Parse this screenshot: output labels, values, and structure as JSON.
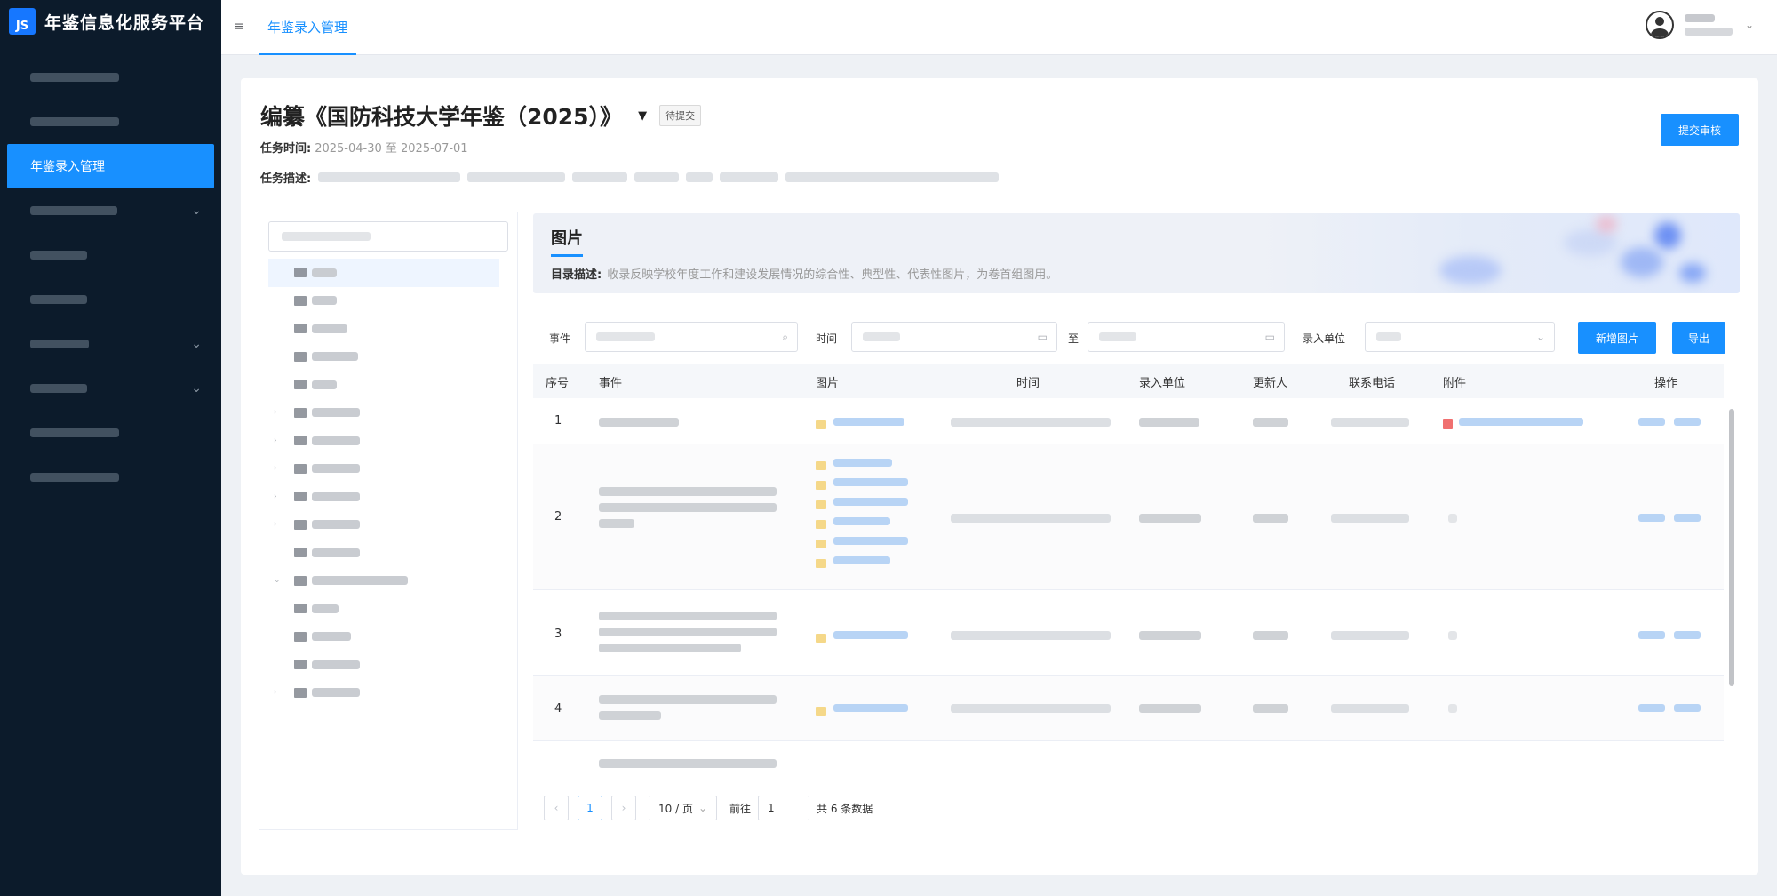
{
  "app": {
    "title": "年鉴信息化服务平台",
    "logo_text": "JS"
  },
  "sidebar": {
    "active_label": "年鉴录入管理",
    "chevron_icon": "chevron-down-icon"
  },
  "header": {
    "tab_label": "年鉴录入管理"
  },
  "task": {
    "title": "编纂《国防科技大学年鉴（2025）》",
    "status": "待提交",
    "time_label": "任务时间:",
    "time_value": "2025-04-30 至 2025-07-01",
    "desc_label": "任务描述:",
    "submit_label": "提交审核"
  },
  "section": {
    "title": "图片",
    "desc_label": "目录描述:",
    "desc_value": "收录反映学校年度工作和建设发展情况的综合性、典型性、代表性图片，为卷首组图用。"
  },
  "filters": {
    "event_label": "事件",
    "time_label": "时间",
    "to_label": "至",
    "unit_label": "录入单位",
    "add_label": "新增图片",
    "export_label": "导出"
  },
  "table": {
    "columns": [
      "序号",
      "事件",
      "图片",
      "时间",
      "录入单位",
      "更新人",
      "联系电话",
      "附件",
      "操作"
    ],
    "rows": [
      {
        "index": "1"
      },
      {
        "index": "2"
      },
      {
        "index": "3"
      },
      {
        "index": "4"
      }
    ]
  },
  "pagination": {
    "current": "1",
    "size_label": "10 / 页",
    "jump_label": "前往",
    "jump_value": "1",
    "total_label": "共 6 条数据"
  },
  "colors": {
    "primary": "#1890ff",
    "sidebar": "#0c1b2b"
  }
}
